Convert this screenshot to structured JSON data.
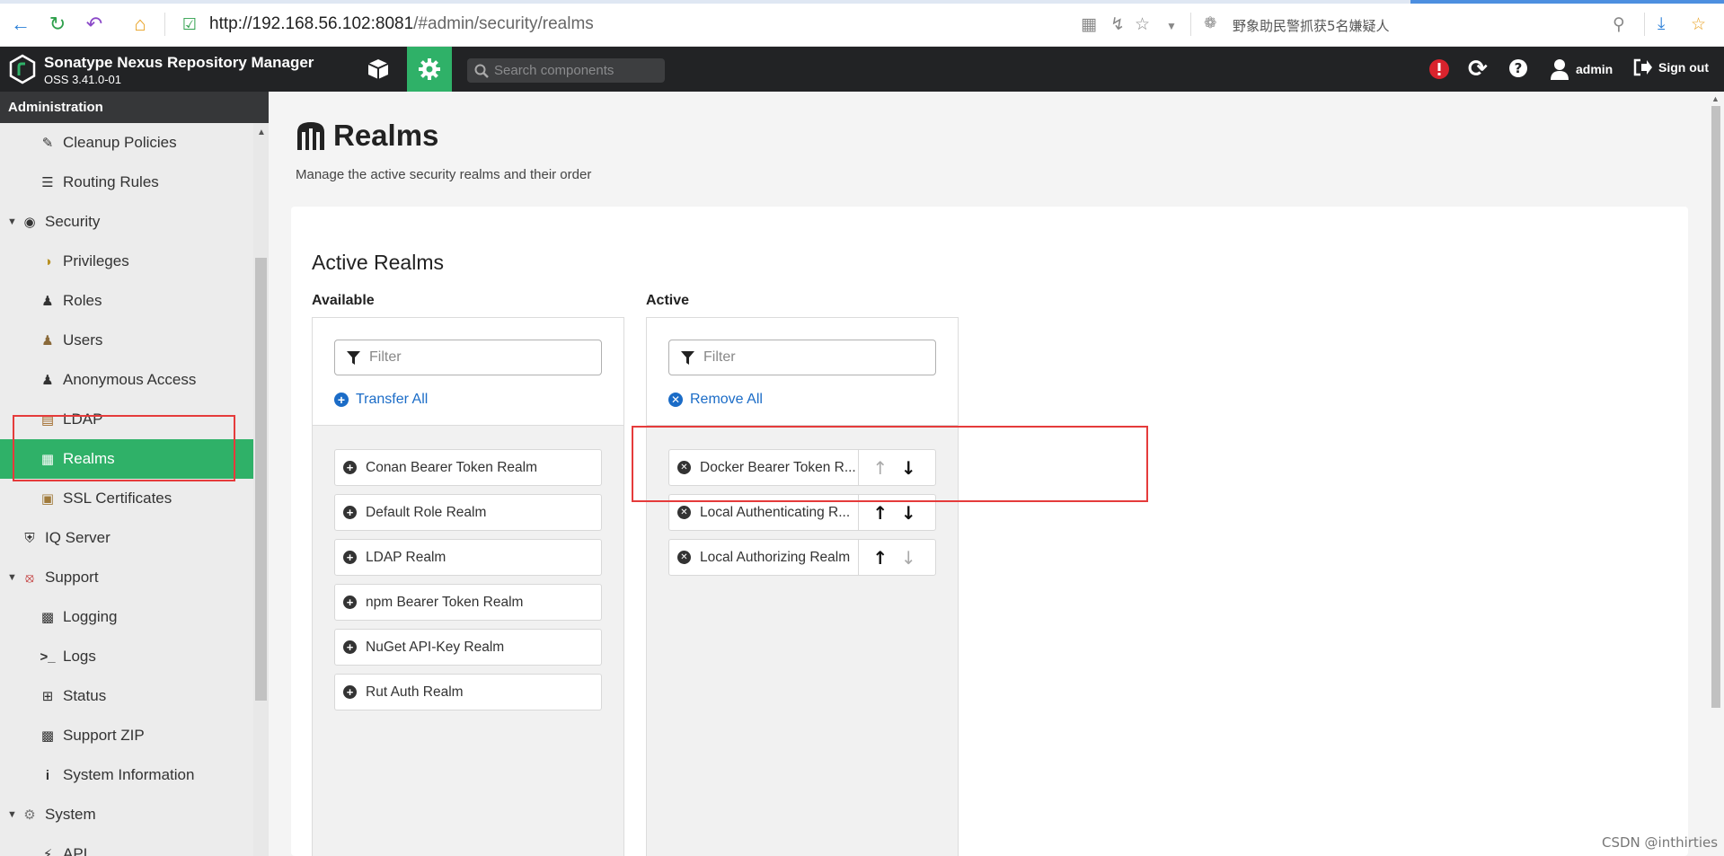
{
  "browser": {
    "url_host": "http://192.168.56.102:8081",
    "url_path": "/#admin/security/realms",
    "news_text": "野象助民警抓获5名嫌疑人"
  },
  "header": {
    "app_title": "Sonatype Nexus Repository Manager",
    "app_version": "OSS 3.41.0-01",
    "search_placeholder": "Search components",
    "user_label": "admin",
    "signout_label": "Sign out"
  },
  "sidebar": {
    "heading": "Administration",
    "items": [
      {
        "label": "Cleanup Policies",
        "icon": "broom-icon",
        "level": "sub"
      },
      {
        "label": "Routing Rules",
        "icon": "signpost-icon",
        "level": "sub"
      },
      {
        "label": "Security",
        "icon": "eye-icon",
        "level": "top"
      },
      {
        "label": "Privileges",
        "icon": "medal-icon",
        "level": "sub"
      },
      {
        "label": "Roles",
        "icon": "user-gear-icon",
        "level": "sub"
      },
      {
        "label": "Users",
        "icon": "users-icon",
        "level": "sub"
      },
      {
        "label": "Anonymous Access",
        "icon": "user-icon",
        "level": "sub"
      },
      {
        "label": "LDAP",
        "icon": "book-icon",
        "level": "sub"
      },
      {
        "label": "Realms",
        "icon": "realm-gate-icon",
        "level": "sub",
        "selected": true
      },
      {
        "label": "SSL Certificates",
        "icon": "certificate-icon",
        "level": "sub"
      },
      {
        "label": "IQ Server",
        "icon": "shield-icon",
        "level": "top"
      },
      {
        "label": "Support",
        "icon": "lifebuoy-icon",
        "level": "top"
      },
      {
        "label": "Logging",
        "icon": "scroll-icon",
        "level": "sub"
      },
      {
        "label": "Logs",
        "icon": "terminal-icon",
        "level": "sub"
      },
      {
        "label": "Status",
        "icon": "medkit-icon",
        "level": "sub"
      },
      {
        "label": "Support ZIP",
        "icon": "zip-file-icon",
        "level": "sub"
      },
      {
        "label": "System Information",
        "icon": "info-icon",
        "level": "sub"
      },
      {
        "label": "System",
        "icon": "cog-icon",
        "level": "top"
      },
      {
        "label": "API",
        "icon": "plug-icon",
        "level": "sub"
      }
    ]
  },
  "main": {
    "title": "Realms",
    "subtitle": "Manage the active security realms and their order",
    "section_title": "Active Realms",
    "available": {
      "label": "Available",
      "filter_placeholder": "Filter",
      "action_label": "Transfer All",
      "realms": [
        "Conan Bearer Token Realm",
        "Default Role Realm",
        "LDAP Realm",
        "npm Bearer Token Realm",
        "NuGet API-Key Realm",
        "Rut Auth Realm"
      ]
    },
    "active": {
      "label": "Active",
      "filter_placeholder": "Filter",
      "action_label": "Remove All",
      "realms": [
        {
          "name": "Docker Bearer Token R...",
          "up_enabled": false,
          "down_enabled": true
        },
        {
          "name": "Local Authenticating R...",
          "up_enabled": true,
          "down_enabled": true
        },
        {
          "name": "Local Authorizing Realm",
          "up_enabled": true,
          "down_enabled": false
        }
      ]
    }
  },
  "watermark": "CSDN @inthirties",
  "colors": {
    "accent_green": "#2fb168",
    "header_dark": "#222325",
    "link_blue": "#1b6cc7",
    "annotation_red": "#e53b3b"
  }
}
